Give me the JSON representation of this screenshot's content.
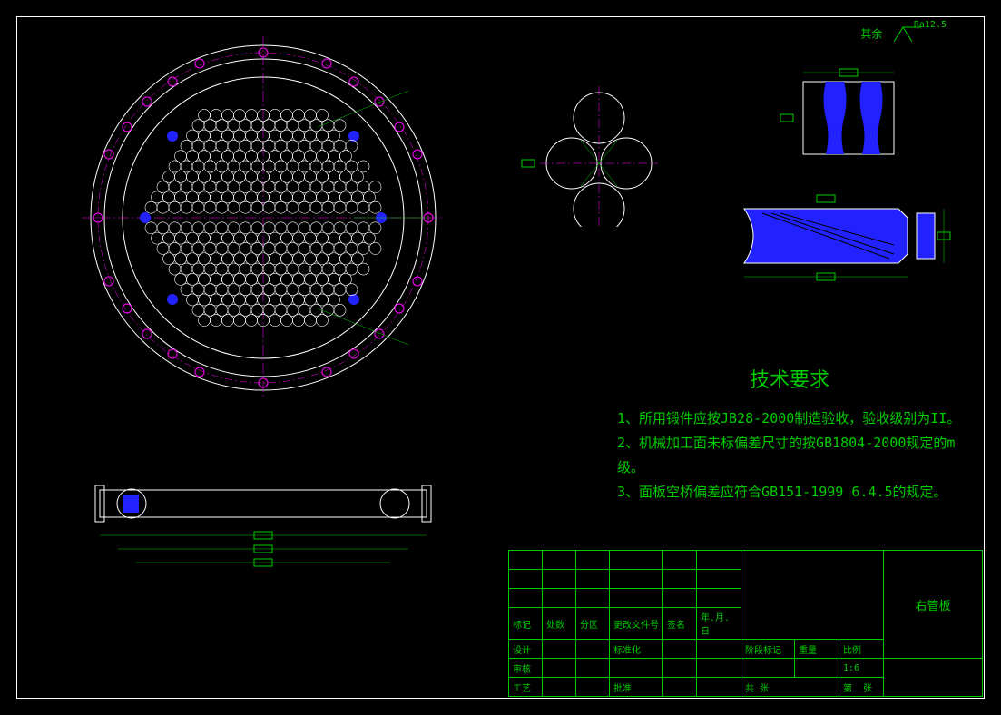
{
  "sheet": {
    "border_color": "#ffffff",
    "canvas_bg": "#000000"
  },
  "surface_finish": {
    "label": "其余",
    "value": "Ra12.5"
  },
  "requirements": {
    "title": "技术要求",
    "items": [
      "1、所用锻件应按JB28-2000制造验收，验收级别为II。",
      "2、机械加工面未标偏差尺寸的按GB1804-2000规定的m级。",
      "3、面板空桥偏差应符合GB151-1999 6.4.5的规定。"
    ]
  },
  "title_block": {
    "part_name": "右管板",
    "headers": [
      "标记",
      "处数",
      "分区",
      "更改文件号",
      "签名",
      "年.月.日"
    ],
    "rows1": [
      "设计",
      "",
      "",
      "标准化",
      "",
      "",
      "阶段标记",
      "重量",
      "比例"
    ],
    "rows2": [
      "审核",
      "",
      "",
      "",
      "",
      "",
      "",
      "",
      "1:6"
    ],
    "rows3": [
      "工艺",
      "",
      "",
      "批准",
      "",
      "",
      "共    张",
      "第",
      "张"
    ]
  },
  "drawing": {
    "main_view": "tubesheet-plan",
    "section_view": "tubesheet-side",
    "detail_a": "tube-hole-pattern",
    "detail_b": "groove-detail-top",
    "detail_c": "groove-detail-bottom"
  }
}
